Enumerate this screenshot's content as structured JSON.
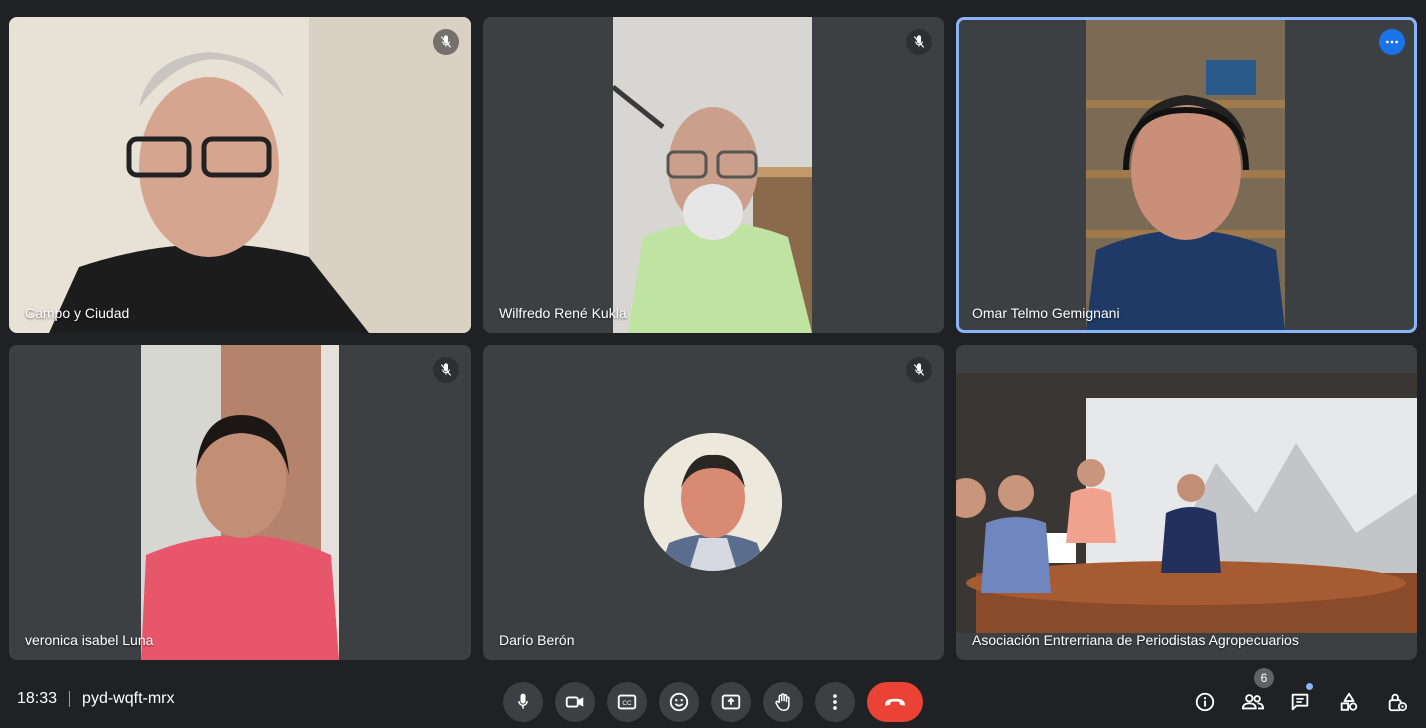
{
  "participants": [
    {
      "name": "Campo y Ciudad"
    },
    {
      "name": "Wilfredo René Kukla"
    },
    {
      "name": "Omar Telmo Gemignani"
    },
    {
      "name": "veronica isabel Luna"
    },
    {
      "name": "Darío Berón"
    },
    {
      "name": "Asociación Entrerriana de Periodistas Agropecuarios"
    }
  ],
  "bottombar": {
    "time": "18:33",
    "meeting_code": "pyd-wqft-mrx",
    "participants_count": "6"
  },
  "icons": {
    "mic": "mic-icon",
    "camera": "videocam-icon",
    "captions": "closed-captions-icon",
    "emoji": "emoji-icon",
    "present": "present-screen-icon",
    "hand": "raise-hand-icon",
    "more": "more-vert-icon",
    "hangup": "call-end-icon",
    "info": "info-icon",
    "people": "people-icon",
    "chat": "chat-icon",
    "activities": "activities-icon",
    "host": "host-controls-icon"
  },
  "colors": {
    "background": "#202124",
    "tile": "#3c4043",
    "active_border": "#8ab4f8",
    "hangup": "#ea4335",
    "more_button": "#1a73e8"
  }
}
